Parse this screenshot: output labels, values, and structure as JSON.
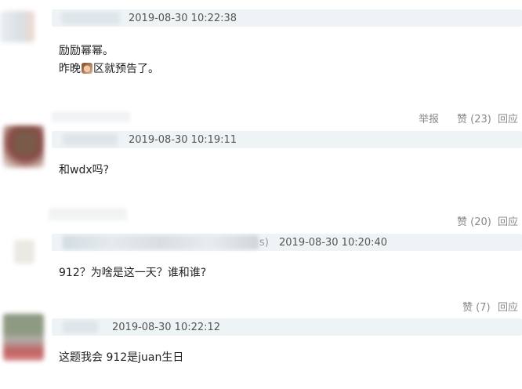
{
  "comments": [
    {
      "timestamp": "2019-08-30 10:22:38",
      "lines": [
        "励励幂幂。",
        "昨晚",
        "区就预告了。"
      ],
      "emoji_icon": "cat-face-emoji"
    },
    {
      "timestamp": "2019-08-30 10:19:11",
      "text": "和wdx吗?"
    },
    {
      "username_suffix": "s)",
      "timestamp": "2019-08-30 10:20:40",
      "text": "912？为啥是这一天？谁和谁?"
    },
    {
      "timestamp": "2019-08-30 10:22:12",
      "text": "这题我会 912是juan生日"
    }
  ],
  "actions": {
    "row1": {
      "report": "举报",
      "like": "赞 (23)",
      "reply": "回应"
    },
    "row2": {
      "like": "赞 (20)",
      "reply": "回应"
    },
    "row3": {
      "like": "赞 (7)",
      "reply": "回应"
    }
  },
  "colors": {
    "header_bg": "#eef3f6",
    "action_text": "#888888",
    "body_text": "#222222"
  }
}
